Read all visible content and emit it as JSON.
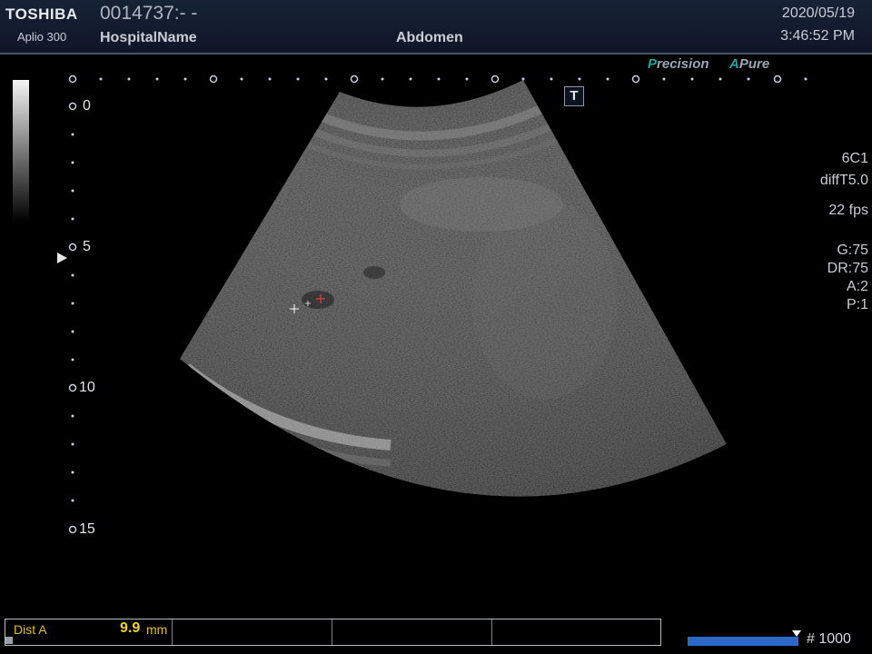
{
  "header": {
    "brand": "TOSHIBA",
    "model": "Aplio 300",
    "patient_id": "0014737:- -",
    "hospital": "HospitalName",
    "preset": "Abdomen",
    "date": "2020/05/19",
    "time": "3:46:52 PM"
  },
  "logos": {
    "precision_p": "P",
    "precision_rest": "recision",
    "apure_a": "A",
    "apure_rest": "Pure"
  },
  "t_icon": "T",
  "depth_scale": [
    "0",
    "5",
    "10",
    "15"
  ],
  "params": {
    "probe": "6C1",
    "mode": "diffT5.0",
    "fps": "22 fps",
    "gain": "G:75",
    "dynamic_range": "DR:75",
    "a": "A:2",
    "p": "P:1"
  },
  "measurement": {
    "label": "Dist A",
    "value": "9.9",
    "unit": "mm"
  },
  "frame": {
    "count": "# 1000"
  },
  "colors": {
    "header_bg": "#141d30",
    "caliper_measured": "#ff4040",
    "measurement_text": "#f2d21a",
    "brand_accent": "#1fa5a0",
    "frame_bar": "#2b68c7"
  }
}
